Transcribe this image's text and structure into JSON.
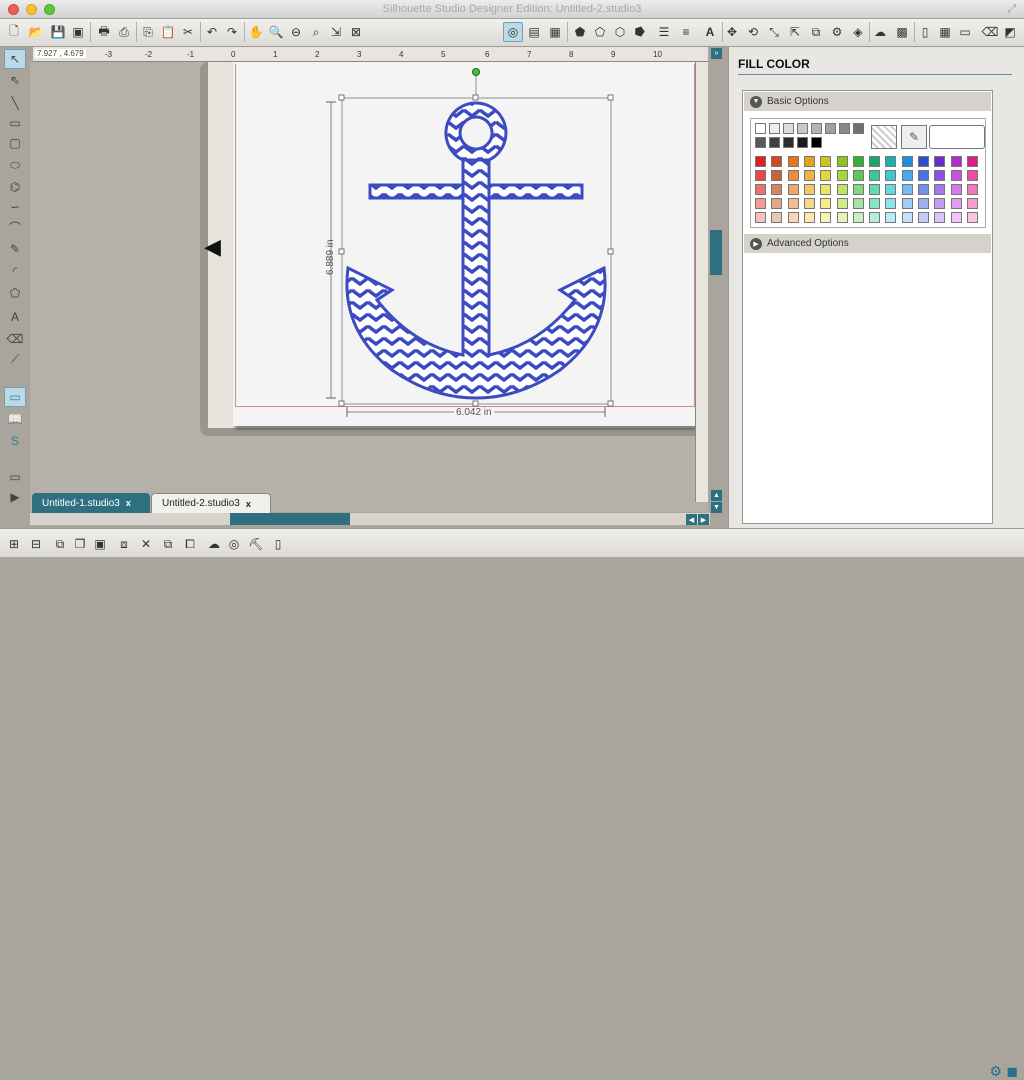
{
  "window": {
    "title": "Silhouette Studio Designer Edition: Untitled-2.studio3"
  },
  "ruler": {
    "coords": "7.927 , 4.679",
    "ticks": [
      "-3",
      "-2",
      "-1",
      "0",
      "1",
      "2",
      "3",
      "4",
      "5",
      "6",
      "7",
      "8",
      "9",
      "10"
    ]
  },
  "canvas": {
    "height_label": "6.889 in",
    "width_label": "6.042 in",
    "shape": "anchor-chevron"
  },
  "tabs": [
    {
      "label": "Untitled-1.studio3",
      "close": "x",
      "active": false
    },
    {
      "label": "Untitled-2.studio3",
      "close": "x",
      "active": true
    }
  ],
  "panel": {
    "title": "FILL COLOR",
    "basic_options": "Basic Options",
    "advanced_options": "Advanced Options",
    "grays": [
      "#ffffff",
      "#eeeeee",
      "#dddddd",
      "#c8c8c8",
      "#b4b4b4",
      "#a0a0a0",
      "#888888",
      "#707070",
      "#585858",
      "#404040",
      "#2c2c2c",
      "#1a1a1a",
      "#000000"
    ],
    "colors": [
      [
        "#e02020",
        "#d04a1c",
        "#e8741a",
        "#e8a21a",
        "#cfc21c",
        "#8dc21f",
        "#36b138",
        "#1aa86a",
        "#1ab0b0",
        "#1e8fe0",
        "#2a4fc8",
        "#6a2ec8",
        "#b02ec8",
        "#e01a8a"
      ],
      [
        "#e84848",
        "#c8643c",
        "#f08a3c",
        "#f0b43c",
        "#e0d83c",
        "#a6d83c",
        "#5cc85c",
        "#3cc896",
        "#3cc8d0",
        "#4aa8f0",
        "#4a72e0",
        "#8a52e0",
        "#c852e0",
        "#f04aa4"
      ],
      [
        "#f07070",
        "#d48660",
        "#f4a464",
        "#f4c864",
        "#eee464",
        "#bee464",
        "#80d880",
        "#64d8b0",
        "#64d8e0",
        "#74bcf4",
        "#7490ec",
        "#a478ec",
        "#d878ec",
        "#f478bc"
      ],
      [
        "#f49898",
        "#dca888",
        "#f8bc8c",
        "#f8d88c",
        "#f4ec8c",
        "#d0ec8c",
        "#a4e4a4",
        "#8ce4c8",
        "#8ce4ec",
        "#9ccef8",
        "#9cb0f2",
        "#c09cf2",
        "#e49cf2",
        "#f89cd0"
      ],
      [
        "#f8c0c0",
        "#e8c8b0",
        "#fbd4b4",
        "#fbe8b4",
        "#f8f4b4",
        "#e4f4b4",
        "#c8eec8",
        "#b4eedc",
        "#b4eef4",
        "#c4e0fb",
        "#c4ccf8",
        "#dac4f8",
        "#f0c4f8",
        "#fbc4e4"
      ]
    ]
  }
}
